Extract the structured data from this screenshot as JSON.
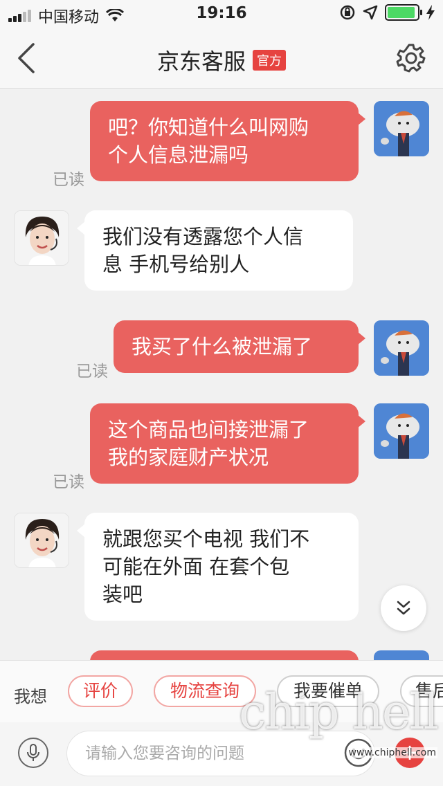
{
  "status_bar": {
    "carrier": "中国移动",
    "time": "19:16"
  },
  "header": {
    "title": "京东客服",
    "badge": "官方"
  },
  "messages": [
    {
      "from": "user",
      "text_lines": [
        "吧？你知道什么叫网购",
        "个人信息泄漏吗"
      ],
      "status": "已读"
    },
    {
      "from": "agent",
      "text_lines": [
        "我们没有透露您个人信",
        "息 手机号给别人"
      ]
    },
    {
      "from": "user",
      "text_lines": [
        "我买了什么被泄漏了"
      ],
      "status": "已读"
    },
    {
      "from": "user",
      "text_lines": [
        "这个商品也间接泄漏了",
        "我的家庭财产状况"
      ],
      "status": "已读"
    },
    {
      "from": "agent",
      "text_lines": [
        "就跟您买个电视 我们不",
        "可能在外面  在套个包",
        "装吧"
      ]
    }
  ],
  "quick_bar": {
    "label": "我想",
    "chips": [
      "评价",
      "物流查询",
      "我要催单",
      "售后"
    ]
  },
  "input": {
    "placeholder": "请输入您要咨询的问题"
  },
  "watermark": {
    "logo": "chip hell",
    "url": "www.chiphell.com"
  },
  "colors": {
    "accent": "#e64340",
    "user_bubble": "#e9625f",
    "battery": "#4cd964"
  },
  "icons": [
    "back-icon",
    "gear-icon",
    "mic-icon",
    "emoji-icon",
    "plus-icon",
    "chevron-double-down-icon",
    "wifi-icon",
    "lock-rotation-icon",
    "location-arrow-icon",
    "charging-bolt-icon"
  ]
}
